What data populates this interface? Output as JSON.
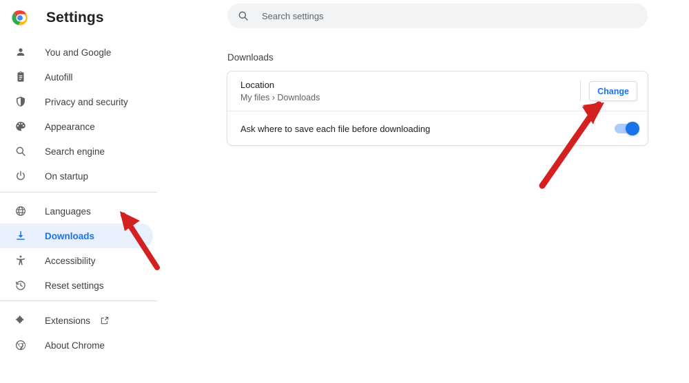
{
  "app": {
    "title": "Settings",
    "logo_icon": "chrome-logo-icon"
  },
  "sidebar": {
    "groups": [
      {
        "items": [
          {
            "label": "You and Google",
            "icon": "person-icon",
            "selected": false
          },
          {
            "label": "Autofill",
            "icon": "clipboard-icon",
            "selected": false
          },
          {
            "label": "Privacy and security",
            "icon": "shield-icon",
            "selected": false
          },
          {
            "label": "Appearance",
            "icon": "palette-icon",
            "selected": false
          },
          {
            "label": "Search engine",
            "icon": "search-icon",
            "selected": false
          },
          {
            "label": "On startup",
            "icon": "power-icon",
            "selected": false
          }
        ]
      },
      {
        "items": [
          {
            "label": "Languages",
            "icon": "globe-icon",
            "selected": false
          },
          {
            "label": "Downloads",
            "icon": "download-icon",
            "selected": true
          },
          {
            "label": "Accessibility",
            "icon": "accessibility-icon",
            "selected": false
          },
          {
            "label": "Reset settings",
            "icon": "history-icon",
            "selected": false
          }
        ]
      },
      {
        "items": [
          {
            "label": "Extensions",
            "icon": "puzzle-icon",
            "selected": false,
            "external": true,
            "external_icon": "open-in-new-icon"
          },
          {
            "label": "About Chrome",
            "icon": "chrome-outline-icon",
            "selected": false,
            "external": false
          }
        ]
      }
    ]
  },
  "search": {
    "placeholder": "Search settings",
    "value": "",
    "icon": "search-icon"
  },
  "main": {
    "section_title": "Downloads",
    "location_row": {
      "label": "Location",
      "value": "My files › Downloads",
      "change_label": "Change"
    },
    "ask_row": {
      "label": "Ask where to save each file before downloading",
      "toggle_state": "on"
    }
  },
  "annotations": {
    "arrows": [
      {
        "name": "arrow-to-change-button",
        "color": "#d32020",
        "direction": "up-right"
      },
      {
        "name": "arrow-to-downloads-nav",
        "color": "#d32020",
        "direction": "up-left"
      }
    ]
  },
  "colors": {
    "accent": "#1a73e8",
    "selected_bg": "#e8f0fe",
    "search_bg": "#f1f3f4",
    "text_primary": "#202124",
    "text_secondary": "#5f6368",
    "annotation_red": "#d32020"
  }
}
